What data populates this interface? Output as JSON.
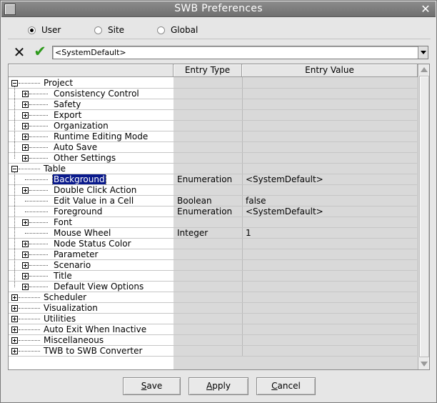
{
  "window": {
    "title": "SWB Preferences",
    "close_glyph": "✕"
  },
  "scope": {
    "options": [
      {
        "label": "User",
        "checked": true
      },
      {
        "label": "Site",
        "checked": false
      },
      {
        "label": "Global",
        "checked": false
      }
    ]
  },
  "toolbar": {
    "cancel_icon": "x-icon",
    "accept_icon": "check-icon",
    "cancel_glyph": "✕",
    "accept_glyph": "✔",
    "combo_value": "<SystemDefault>"
  },
  "table": {
    "headers": {
      "name": "",
      "entry_type": "Entry Type",
      "entry_value": "Entry Value"
    },
    "rows": [
      {
        "label": "Project",
        "level": 0,
        "expander": "minus",
        "type": "",
        "value": ""
      },
      {
        "label": "Consistency Control",
        "level": 1,
        "expander": "plus",
        "type": "",
        "value": ""
      },
      {
        "label": "Safety",
        "level": 1,
        "expander": "plus",
        "type": "",
        "value": ""
      },
      {
        "label": "Export",
        "level": 1,
        "expander": "plus",
        "type": "",
        "value": ""
      },
      {
        "label": "Organization",
        "level": 1,
        "expander": "plus",
        "type": "",
        "value": ""
      },
      {
        "label": "Runtime Editing Mode",
        "level": 1,
        "expander": "plus",
        "type": "",
        "value": ""
      },
      {
        "label": "Auto Save",
        "level": 1,
        "expander": "plus",
        "type": "",
        "value": ""
      },
      {
        "label": "Other Settings",
        "level": 1,
        "expander": "plus",
        "type": "",
        "value": ""
      },
      {
        "label": "Table",
        "level": 0,
        "expander": "minus",
        "type": "",
        "value": ""
      },
      {
        "label": "Background",
        "level": 1,
        "expander": "none",
        "type": "Enumeration",
        "value": "<SystemDefault>",
        "selected": true
      },
      {
        "label": "Double Click Action",
        "level": 1,
        "expander": "plus",
        "type": "",
        "value": ""
      },
      {
        "label": "Edit Value in a Cell",
        "level": 1,
        "expander": "none",
        "type": "Boolean",
        "value": "false"
      },
      {
        "label": "Foreground",
        "level": 1,
        "expander": "none",
        "type": "Enumeration",
        "value": "<SystemDefault>"
      },
      {
        "label": "Font",
        "level": 1,
        "expander": "plus",
        "type": "",
        "value": ""
      },
      {
        "label": "Mouse Wheel",
        "level": 1,
        "expander": "none",
        "type": "Integer",
        "value": "1"
      },
      {
        "label": "Node Status Color",
        "level": 1,
        "expander": "plus",
        "type": "",
        "value": ""
      },
      {
        "label": "Parameter",
        "level": 1,
        "expander": "plus",
        "type": "",
        "value": ""
      },
      {
        "label": "Scenario",
        "level": 1,
        "expander": "plus",
        "type": "",
        "value": ""
      },
      {
        "label": "Title",
        "level": 1,
        "expander": "plus",
        "type": "",
        "value": ""
      },
      {
        "label": "Default View Options",
        "level": 1,
        "expander": "plus",
        "type": "",
        "value": ""
      },
      {
        "label": "Scheduler",
        "level": 0,
        "expander": "plus",
        "type": "",
        "value": ""
      },
      {
        "label": "Visualization",
        "level": 0,
        "expander": "plus",
        "type": "",
        "value": ""
      },
      {
        "label": "Utilities",
        "level": 0,
        "expander": "plus",
        "type": "",
        "value": ""
      },
      {
        "label": "Auto Exit When Inactive",
        "level": 0,
        "expander": "plus",
        "type": "",
        "value": ""
      },
      {
        "label": "Miscellaneous",
        "level": 0,
        "expander": "plus",
        "type": "",
        "value": ""
      },
      {
        "label": "TWB to SWB Converter",
        "level": 0,
        "expander": "plus",
        "type": "",
        "value": ""
      }
    ]
  },
  "buttons": {
    "save": {
      "label_first": "S",
      "label_rest": "ave"
    },
    "apply": {
      "label_first": "A",
      "label_rest": "pply"
    },
    "cancel": {
      "label_first": "C",
      "label_rest": "ancel"
    }
  },
  "colors": {
    "selection": "#0a1a8c",
    "accept_green": "#2e9a1c",
    "title_bar": "#7a7a7a"
  }
}
